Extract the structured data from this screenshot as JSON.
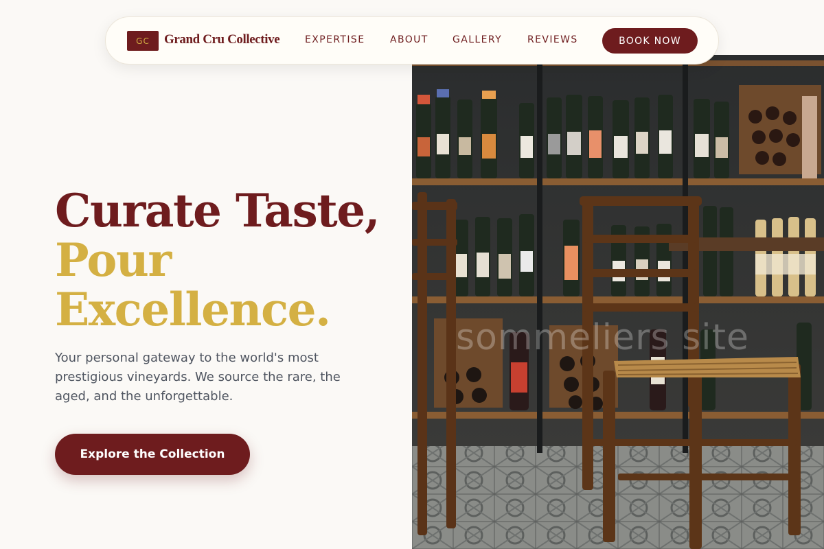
{
  "brand": {
    "badge": "GC",
    "name": "Grand Cru Collective"
  },
  "nav": {
    "links": [
      "EXPERTISE",
      "ABOUT",
      "GALLERY",
      "REVIEWS"
    ],
    "cta": "BOOK NOW"
  },
  "hero": {
    "line1": "Curate Taste,",
    "line2": "Pour",
    "line3": "Excellence.",
    "subtitle": "Your personal gateway to the world's most prestigious vineyards. We source the rare, the aged, and the unforgettable.",
    "button": "Explore the Collection"
  },
  "image": {
    "watermark": "sommeliers site"
  },
  "colors": {
    "burgundy": "#6e1c1e",
    "gold": "#d4b043",
    "background": "#fbf9f6",
    "body_text": "#4f5560"
  }
}
